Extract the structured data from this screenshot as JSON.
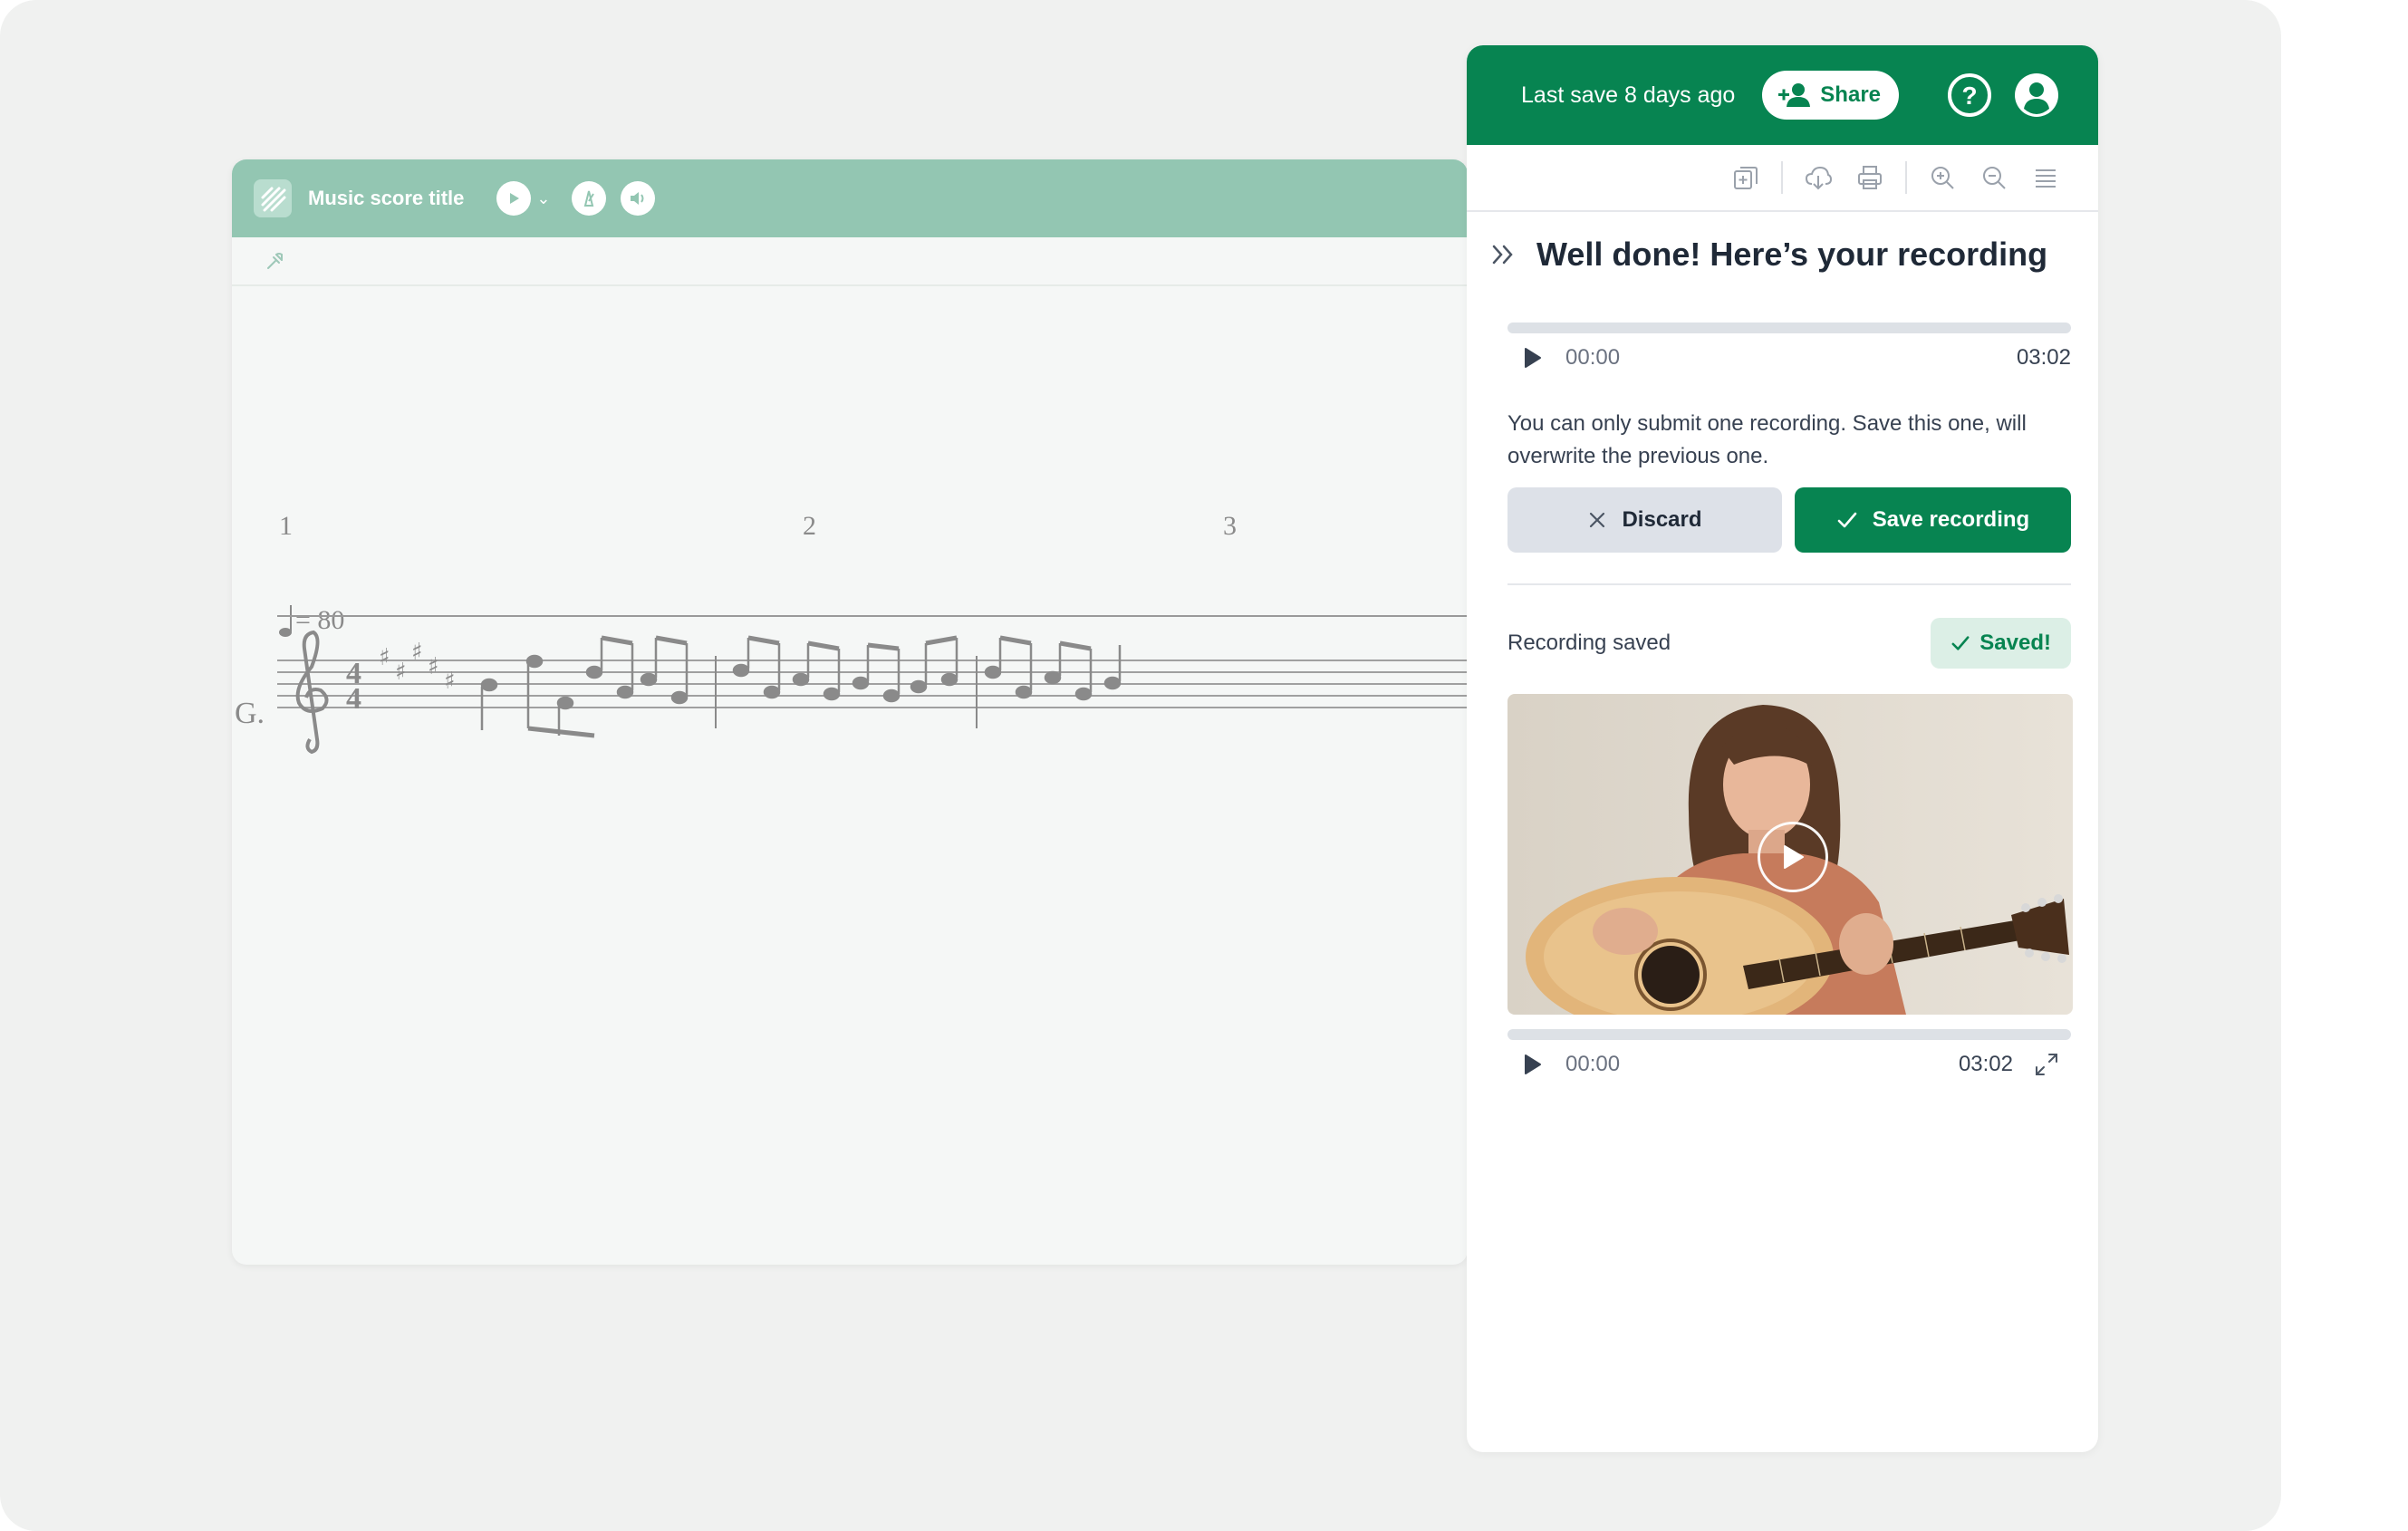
{
  "score": {
    "title": "Music score title",
    "measures": [
      "1",
      "2",
      "3"
    ],
    "tempo": "= 80",
    "instrument": "G."
  },
  "panel": {
    "header": {
      "last_save": "Last save 8 days ago",
      "share_label": "Share"
    },
    "recording": {
      "title": "Well done! Here’s your recording",
      "current_time": "00:00",
      "total_time": "03:02",
      "note": "You can only submit one recording. Save this one, will overwrite the previous one.",
      "discard_label": "Discard",
      "save_label": "Save recording"
    },
    "saved": {
      "label": "Recording saved",
      "badge": "Saved!",
      "current_time": "00:00",
      "total_time": "03:02"
    }
  },
  "colors": {
    "brand": "#078451",
    "score_header": "#93c6b2",
    "muted": "#dde1e8"
  }
}
